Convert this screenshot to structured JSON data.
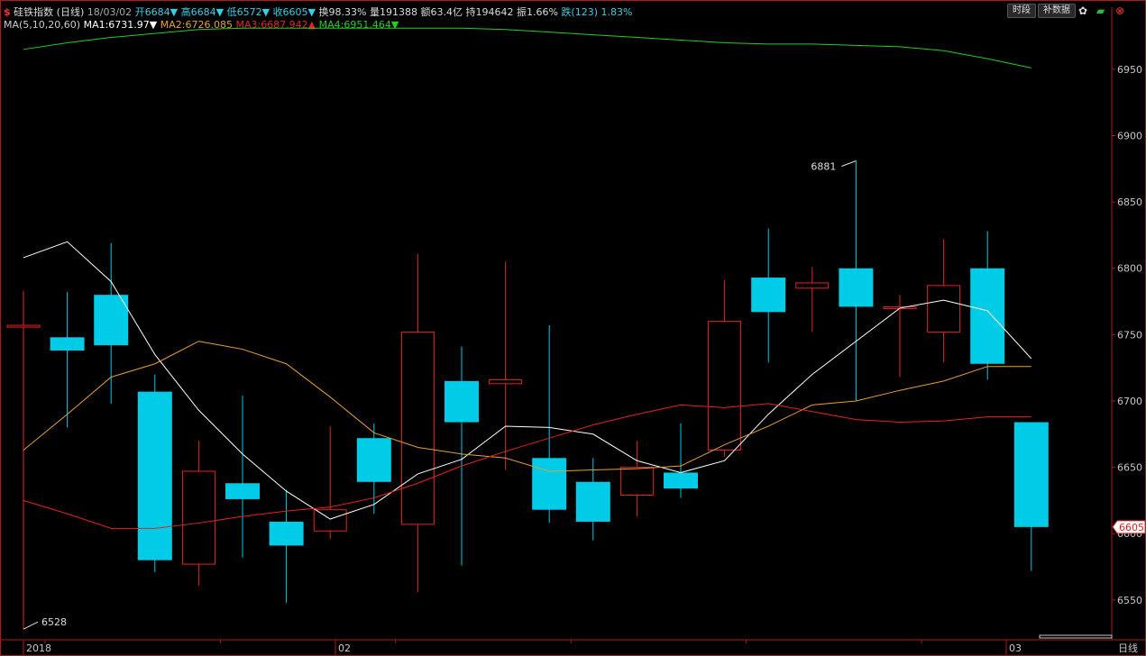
{
  "header": {
    "icon": "$",
    "name": "硅铁指数",
    "period": "(日线)",
    "date": "18/03/02",
    "fields": [
      {
        "label": "开",
        "value": "6684",
        "arrow": "▼",
        "color": "#35d0e6"
      },
      {
        "label": "高",
        "value": "6684",
        "arrow": "▼",
        "color": "#35d0e6"
      },
      {
        "label": "低",
        "value": "6572",
        "arrow": "▼",
        "color": "#35d0e6"
      },
      {
        "label": "收",
        "value": "6605",
        "arrow": "▼",
        "color": "#35d0e6"
      },
      {
        "label": "换",
        "value": "98.33%",
        "arrow": "",
        "color": "#dddddd"
      },
      {
        "label": "量",
        "value": "191388",
        "arrow": "",
        "color": "#dddddd"
      },
      {
        "label": "额",
        "value": "63.4亿",
        "arrow": "",
        "color": "#dddddd"
      },
      {
        "label": "持",
        "value": "194642",
        "arrow": "",
        "color": "#dddddd"
      },
      {
        "label": "振",
        "value": "1.66%",
        "arrow": "",
        "color": "#dddddd"
      },
      {
        "label": "跌",
        "value": "(123) 1.83%",
        "arrow": "",
        "color": "#35d0e6"
      }
    ],
    "ma_params": "MA(5,10,20,60)",
    "ma_values": [
      {
        "label": "MA1:",
        "value": "6731.97",
        "arrow": "▼",
        "color": "#ffffff"
      },
      {
        "label": "MA2:",
        "value": "6726.085",
        "arrow": "",
        "color": "#e8a030"
      },
      {
        "label": "MA3:",
        "value": "6687.942",
        "arrow": "▲",
        "color": "#e82020"
      },
      {
        "label": "MA4:",
        "value": "6951.464",
        "arrow": "▼",
        "color": "#20d020"
      }
    ]
  },
  "toolbar": {
    "period_button": "时段",
    "restore_button": "补数据",
    "icons": [
      "settings-icon",
      "chart-icon",
      "close-icon"
    ]
  },
  "footer": {
    "x_labels": [
      "2018",
      "02",
      "03"
    ],
    "period_label": "日线"
  },
  "chart_data": {
    "type": "candlestick",
    "ylim": [
      6520,
      6990
    ],
    "y_ticks": [
      6550,
      6600,
      6650,
      6700,
      6750,
      6800,
      6850,
      6900,
      6950
    ],
    "last_price": "6605",
    "candles": [
      {
        "o": 6757,
        "h": 6783,
        "l": 6528,
        "c": 6757
      },
      {
        "o": 6748,
        "h": 6782,
        "l": 6680,
        "c": 6738
      },
      {
        "o": 6780,
        "h": 6819,
        "l": 6698,
        "c": 6742
      },
      {
        "o": 6707,
        "h": 6720,
        "l": 6571,
        "c": 6580
      },
      {
        "o": 6577,
        "h": 6670,
        "l": 6561,
        "c": 6647
      },
      {
        "o": 6638,
        "h": 6704,
        "l": 6582,
        "c": 6626
      },
      {
        "o": 6609,
        "h": 6633,
        "l": 6548,
        "c": 6591
      },
      {
        "o": 6602,
        "h": 6681,
        "l": 6596,
        "c": 6618
      },
      {
        "o": 6672,
        "h": 6683,
        "l": 6615,
        "c": 6639
      },
      {
        "o": 6607,
        "h": 6811,
        "l": 6556,
        "c": 6752
      },
      {
        "o": 6715,
        "h": 6741,
        "l": 6576,
        "c": 6684
      },
      {
        "o": 6713,
        "h": 6805,
        "l": 6648,
        "c": 6716
      },
      {
        "o": 6657,
        "h": 6757,
        "l": 6608,
        "c": 6618
      },
      {
        "o": 6639,
        "h": 6657,
        "l": 6595,
        "c": 6609
      },
      {
        "o": 6629,
        "h": 6670,
        "l": 6613,
        "c": 6650
      },
      {
        "o": 6646,
        "h": 6683,
        "l": 6627,
        "c": 6634
      },
      {
        "o": 6663,
        "h": 6791,
        "l": 6658,
        "c": 6760
      },
      {
        "o": 6793,
        "h": 6830,
        "l": 6729,
        "c": 6767
      },
      {
        "o": 6785,
        "h": 6801,
        "l": 6752,
        "c": 6789
      },
      {
        "o": 6800,
        "h": 6881,
        "l": 6700,
        "c": 6771
      },
      {
        "o": 6771,
        "h": 6780,
        "l": 6718,
        "c": 6771
      },
      {
        "o": 6752,
        "h": 6822,
        "l": 6729,
        "c": 6787
      },
      {
        "o": 6800,
        "h": 6828,
        "l": 6716,
        "c": 6728
      },
      {
        "o": 6684,
        "h": 6684,
        "l": 6572,
        "c": 6605
      }
    ],
    "annotations": [
      {
        "index": 0,
        "value": 6528,
        "label": "6528"
      },
      {
        "index": 19,
        "value": 6881,
        "label": "6881"
      }
    ],
    "series": [
      {
        "name": "MA1",
        "color": "#ffffff",
        "values": [
          6808,
          6820,
          6790,
          6735,
          6693,
          6660,
          6632,
          6611,
          6622,
          6645,
          6656,
          6681,
          6680,
          6675,
          6655,
          6646,
          6655,
          6690,
          6720,
          6745,
          6770,
          6776,
          6768,
          6732
        ]
      },
      {
        "name": "MA2",
        "color": "#e8a030",
        "values": [
          6663,
          6690,
          6718,
          6728,
          6745,
          6739,
          6728,
          6703,
          6676,
          6665,
          6660,
          6657,
          6647,
          6648,
          6649,
          6651,
          6667,
          6681,
          6697,
          6700,
          6708,
          6715,
          6726,
          6726
        ]
      },
      {
        "name": "MA3",
        "color": "#e82020",
        "values": [
          6625,
          6615,
          6604,
          6604,
          6608,
          6613,
          6617,
          6620,
          6627,
          6638,
          6651,
          6662,
          6672,
          6682,
          6690,
          6697,
          6695,
          6698,
          6692,
          6686,
          6684,
          6685,
          6688,
          6688
        ]
      },
      {
        "name": "MA4",
        "color": "#20d020",
        "values": [
          6965,
          6970,
          6974,
          6977,
          6980,
          6981,
          6981,
          6981,
          6981,
          6981,
          6981,
          6980,
          6978,
          6976,
          6974,
          6972,
          6970,
          6969,
          6969,
          6968,
          6967,
          6964,
          6958,
          6951
        ]
      }
    ]
  }
}
